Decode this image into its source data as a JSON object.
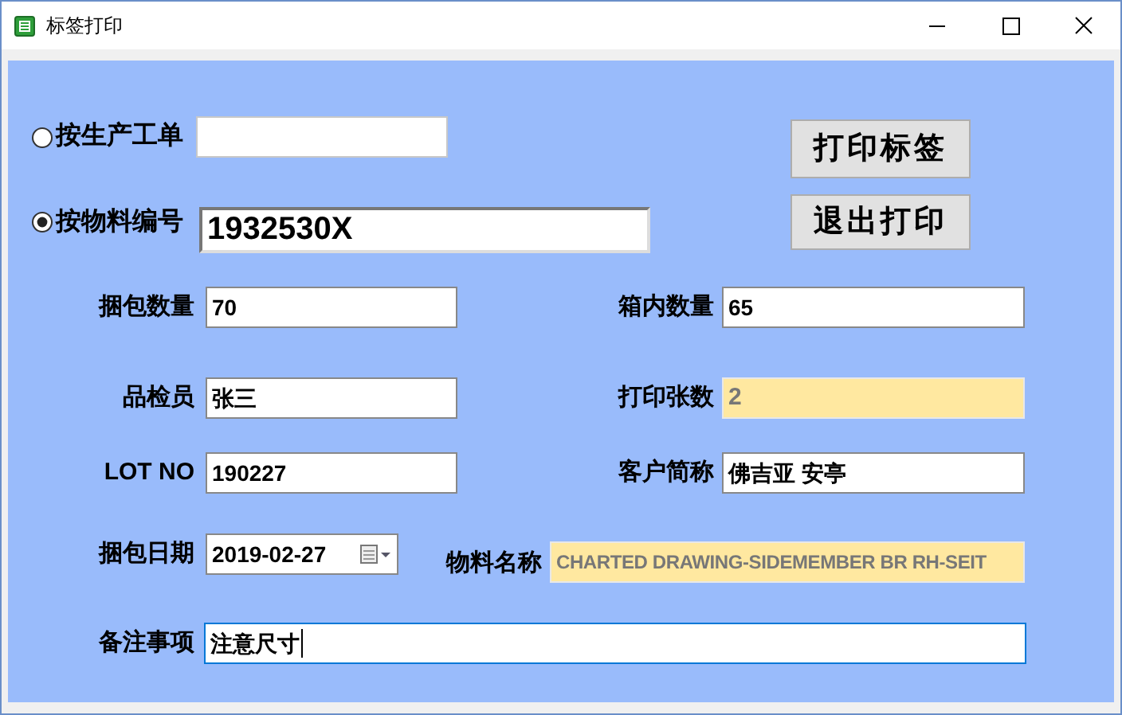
{
  "window": {
    "title": "标签打印"
  },
  "query_modes": [
    {
      "label": "按生产工单",
      "selected": false
    },
    {
      "label": "按物料编号",
      "selected": true,
      "value": "1932530X"
    }
  ],
  "buttons": [
    "打印标签",
    "退出打印"
  ],
  "fields": [
    {
      "label": "捆包数量",
      "value": "70",
      "kind": "text",
      "focused": false
    },
    {
      "label": "箱内数量",
      "value": "65",
      "kind": "text",
      "focused": false
    },
    {
      "label": "品检员",
      "value": "张三",
      "kind": "text",
      "focused": false
    },
    {
      "label": "打印张数",
      "value": "2",
      "kind": "readonly",
      "focused": false
    },
    {
      "label": "LOT NO",
      "value": "190227",
      "kind": "text",
      "focused": false
    },
    {
      "label": "客户简称",
      "value": "佛吉亚 安亭",
      "kind": "text",
      "focused": false
    },
    {
      "label": "捆包日期",
      "value": "2019-02-27",
      "kind": "date",
      "focused": false
    },
    {
      "label": "物料名称",
      "value": "CHARTED DRAWING-SIDEMEMBER BR RH-SEIT",
      "kind": "readonly",
      "focused": false
    },
    {
      "label": "备注事项",
      "value": "注意尺寸",
      "kind": "text",
      "focused": true
    }
  ]
}
